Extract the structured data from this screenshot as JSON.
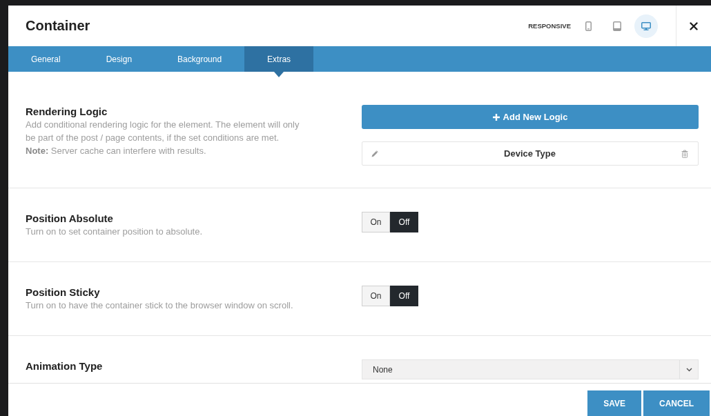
{
  "window": {
    "title": "Container"
  },
  "responsive": {
    "label": "RESPONSIVE",
    "devices": [
      {
        "kind": "phone",
        "selected": false
      },
      {
        "kind": "tablet",
        "selected": false
      },
      {
        "kind": "desktop",
        "selected": true
      }
    ]
  },
  "tabs": [
    {
      "label": "General",
      "selected": false
    },
    {
      "label": "Design",
      "selected": false
    },
    {
      "label": "Background",
      "selected": false
    },
    {
      "label": "Extras",
      "selected": true
    }
  ],
  "sections": [
    {
      "kind": "logic",
      "title": "Rendering Logic",
      "description": "Add conditional rendering logic for the element. The element will only be part of the post / page contents, if the set conditions are met.",
      "note": "**Note:** Server cache can interfere with results.",
      "add_button": {
        "label": "Add New Logic"
      },
      "rules": [
        {
          "label": "Device Type"
        }
      ]
    },
    {
      "kind": "toggle",
      "title": "Position Absolute",
      "description": "Turn on to set container position to absolute.",
      "options": [
        {
          "label": "On",
          "selected": false
        },
        {
          "label": "Off",
          "selected": true
        }
      ]
    },
    {
      "kind": "toggle",
      "title": "Position Sticky",
      "description": "Turn on to have the container stick to the browser window on scroll.",
      "options": [
        {
          "label": "On",
          "selected": false
        },
        {
          "label": "Off",
          "selected": true
        }
      ]
    },
    {
      "kind": "select",
      "title": "Animation Type",
      "value": "None"
    }
  ],
  "footer": {
    "buttons": [
      "SAVE",
      "CANCEL"
    ]
  }
}
